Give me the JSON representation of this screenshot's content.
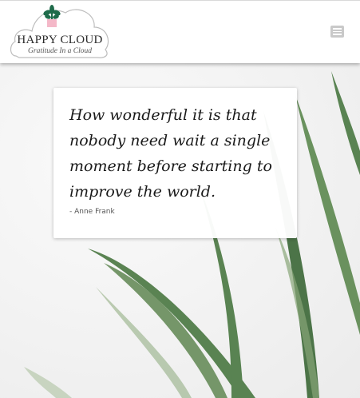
{
  "header": {
    "brand_name": "HAPPY CLOUD",
    "tagline": "Gratitude In a Cloud",
    "menu_icon": "hamburger-menu-icon"
  },
  "quote": {
    "text": "How wonderful it is that nobody need wait a single moment before starting to improve the world.",
    "author": "- Anne Frank"
  },
  "colors": {
    "leaf_green": "#4d7a45",
    "flower_pot": "#f4b8c8",
    "plant_green": "#1f6b4a",
    "menu_gray": "#c9c9c9"
  }
}
